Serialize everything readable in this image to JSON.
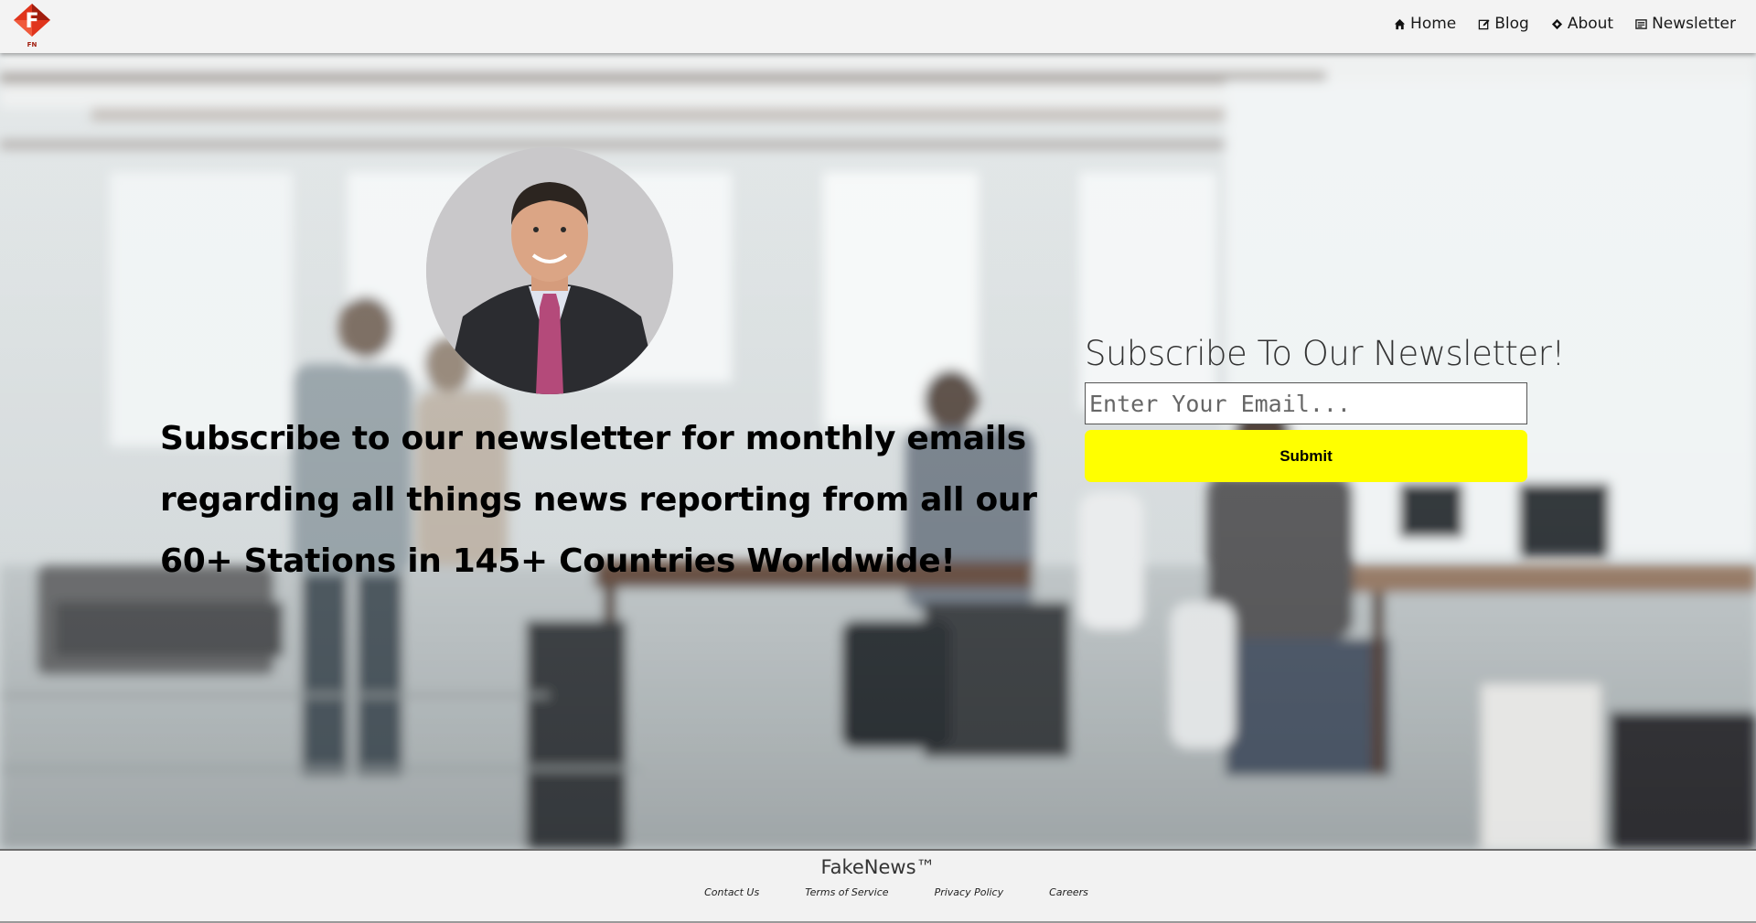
{
  "brand": {
    "logo_letter": "F",
    "logo_text": "FN"
  },
  "nav": {
    "items": [
      {
        "label": "Home",
        "icon": "home-icon"
      },
      {
        "label": "Blog",
        "icon": "edit-icon"
      },
      {
        "label": "About",
        "icon": "diamond-icon"
      },
      {
        "label": "Newsletter",
        "icon": "newspaper-icon"
      }
    ]
  },
  "hero": {
    "promo_text": "Subscribe to our newsletter for monthly emails regarding all things news reporting from all our 60+ Stations in 145+ Countries Worldwide!",
    "subscribe_title": "Subscribe To Our Newsletter!",
    "email_placeholder": "Enter Your Email...",
    "email_value": "",
    "submit_label": "Submit"
  },
  "footer": {
    "brand": "FakeNews™",
    "links": [
      "Contact Us",
      "Terms of Service",
      "Privacy Policy",
      "Careers"
    ]
  },
  "colors": {
    "accent": "#ffff00",
    "logo_red": "#e0341c",
    "logo_dark": "#a11d0e"
  }
}
